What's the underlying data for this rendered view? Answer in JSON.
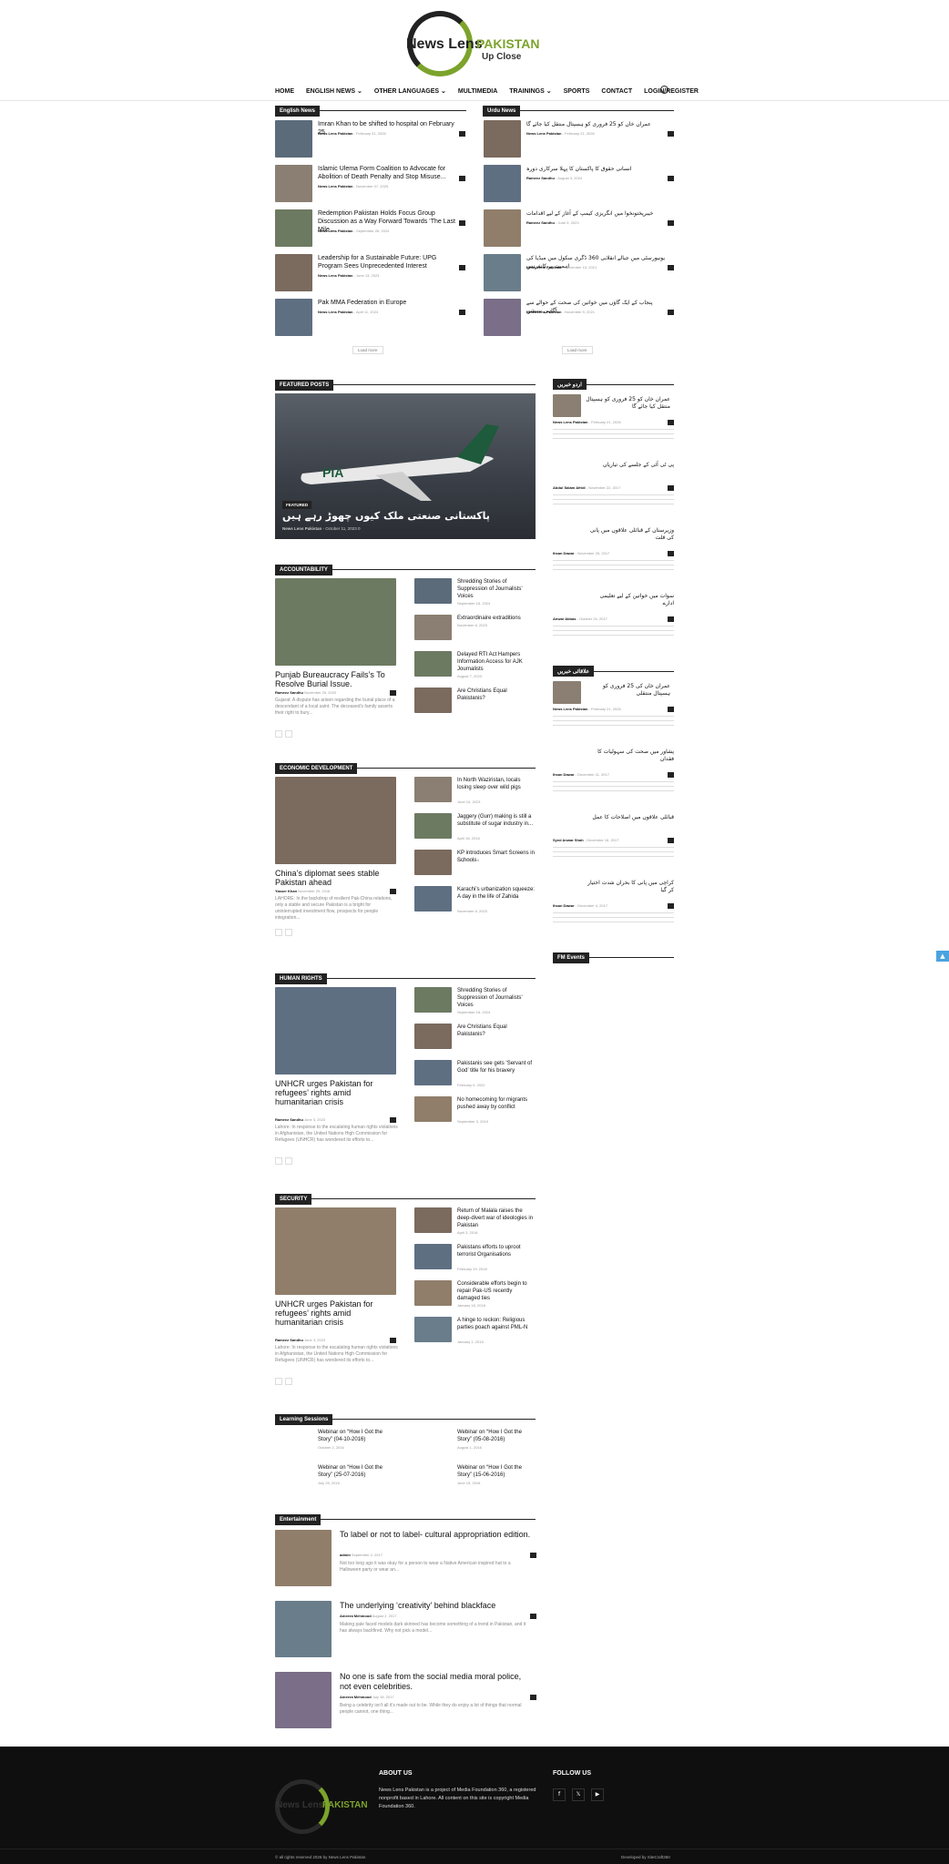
{
  "brand": {
    "line1": "News Lens",
    "line2": "PAKISTAN",
    "line3": "Up Close"
  },
  "nav": [
    "HOME",
    "ENGLISH NEWS ⌄",
    "OTHER LANGUAGES ⌄",
    "MULTIMEDIA",
    "TRAININGS ⌄",
    "SPORTS",
    "CONTACT",
    "LOGIN/REGISTER"
  ],
  "english_news": {
    "title": "English News",
    "load_more": "Load more",
    "items": [
      {
        "title": "Imran Khan to be shifted to hospital on February 25",
        "author": "News Lens Pakistan",
        "date": "February 21, 2026"
      },
      {
        "title": "Islamic Ulema Form Coalition to Advocate for Abolition of Death Penalty and Stop Misuse...",
        "author": "News Lens Pakistan",
        "date": "November 07, 2025"
      },
      {
        "title": "Redemption Pakistan Holds Focus Group Discussion as a Way Forward Towards ‘The Last Mile...",
        "author": "News Lens Pakistan",
        "date": "September 26, 2024"
      },
      {
        "title": "Leadership for a Sustainable Future: UPG Program Sees Unprecedented Interest",
        "author": "News Lens Pakistan",
        "date": "June 13, 2023"
      },
      {
        "title": "Pak MMA Federation in Europe",
        "author": "News Lens Pakistan",
        "date": "April 11, 2024"
      }
    ]
  },
  "urdu_news": {
    "title": "Urdu News",
    "load_more": "Load more",
    "items": [
      {
        "title": "عمران خان کو 25 فروری کو ہسپتال منتقل کیا جائے گا",
        "author": "News Lens Pakistan",
        "date": "February 21, 2026"
      },
      {
        "title": "انسانی حقوق کا پاکستان کا پہلا سرکاری دورہ",
        "author": "Rameez Sandhu",
        "date": "August 3, 2024"
      },
      {
        "title": "خیبرپختونخوا میں انگریزی کیمپ کے آغاز کے لیے اقدامات",
        "author": "Rameez Sandhu",
        "date": "June 5, 2023"
      },
      {
        "title": "یونیورسٹی میں جیالے انقلابی 360 ڈگری سکول میں میڈیا کی اہمیت پر کانفرنس",
        "author": "News Lens Pakistan",
        "date": "December 15, 2021"
      },
      {
        "title": "پنجاب کے ایک گاؤں میں خواتین کی صحت کے حوالے سے آگاہی سیشن",
        "author": "News Lens Pakistan",
        "date": "November 9, 2021"
      }
    ]
  },
  "featured": {
    "title": "FEATURED POSTS",
    "tag": "FEATURED",
    "headline": "پاکستانی صنعتی ملک کیوں چھوڑ رہے ہیں",
    "author": "News Lens Pakistan",
    "date": "October 11, 2023",
    "comments": "0",
    "tail": "PIA"
  },
  "urdu_side": {
    "title": "اردو خبریں",
    "items": [
      {
        "title": "عمران خان کو 25 فروری کو ہسپتال منتقل کیا جائے گا",
        "author": "News Lens Pakistan",
        "date": "February 21, 2026"
      },
      {
        "title": "پی ٹی آئی کے جلسے کی تیاریاں",
        "author": "Abdul Salam Afridi",
        "date": "November 22, 2017"
      },
      {
        "title": "وزیرستان کے قبائلی علاقوں میں پانی کی قلت",
        "author": "Ihsan Dawar",
        "date": "November 25, 2017"
      },
      {
        "title": "سوات میں خواتین کے لیے تعلیمی ادارے",
        "author": "Anwar Abbas",
        "date": "October 24, 2017"
      }
    ]
  },
  "regional_side": {
    "title": "علاقائی خبریں",
    "items": [
      {
        "title": "عمران خان کی 25 فروری کو ہسپتال منتقلی",
        "author": "News Lens Pakistan",
        "date": "February 21, 2026"
      },
      {
        "title": "پشاور میں صحت کی سہولیات کا فقدان",
        "author": "Ihsan Dawar",
        "date": "December 11, 2017"
      },
      {
        "title": "قبائلی علاقوں میں اصلاحات کا عمل",
        "author": "Syed Anwar Shah",
        "date": "December 18, 2017"
      },
      {
        "title": "کراچی میں پانی کا بحران شدت اختیار کر گیا",
        "author": "Ihsan Dawar",
        "date": "December 4, 2017"
      }
    ]
  },
  "fm_events": {
    "title": "FM Events"
  },
  "accountability": {
    "title": "ACCOUNTABILITY",
    "main": {
      "title": "Punjab Bureaucracy Fails’s To Resolve Burial Issue.",
      "author": "Rameez Sandhu",
      "date": "November 25, 2020",
      "excerpt": "Gujarat: A dispute has arisen regarding the burial place of a descendant of a local saint. The deceased's family asserts their right to bury..."
    },
    "side": [
      {
        "title": "Shredding Stories of Suppression of Journalists’ Voices",
        "date": "September 18, 2024"
      },
      {
        "title": "Extraordinaire extraditions",
        "date": "November 6, 2023"
      },
      {
        "title": "Delayed RTI Act Hampers Information Access for AJK Journalists",
        "date": "August 7, 2023"
      },
      {
        "title": "Are Christians Equal Pakistanis?",
        "date": "June 3, 2023"
      }
    ]
  },
  "economic": {
    "title": "ECONOMIC DEVELOPMENT",
    "main": {
      "title": "China’s diplomat sees stable Pakistan ahead",
      "author": "Yasser Khan",
      "date": "November 29, 2016",
      "excerpt": "LAHORE: In the backdrop of resilient Pak-China relations, only a stable and secure Pakistan is a bright for uninterrupted investment flow, prospects for people integration..."
    },
    "side": [
      {
        "title": "In North Waziristan, locals losing sleep over wild pigs",
        "date": "June 10, 2023"
      },
      {
        "title": "Jaggery (Gurr) making is still a substitute of sugar industry in...",
        "date": "April 18, 2018"
      },
      {
        "title": "KP introduces Smart Screens in Schools",
        "date": "May 23, 2018"
      },
      {
        "title": "Karachi’s urbanization squeeze: A day in the life of Zahida",
        "date": "November 6, 2023"
      }
    ]
  },
  "human_rights": {
    "title": "HUMAN RIGHTS",
    "main": {
      "title": "UNHCR urges Pakistan for refugees’ rights amid humanitarian crisis",
      "author": "Rameez Sandhu",
      "date": "June 3, 2023",
      "excerpt": "Lahore: In response to the escalating human rights violations in Afghanistan, the United Nations High Commission for Refugees (UNHCR) has wondered its efforts to..."
    },
    "side": [
      {
        "title": "Shredding Stories of Suppression of Journalists’ Voices",
        "date": "September 18, 2024"
      },
      {
        "title": "Are Christians Equal Pakistanis?",
        "date": "June 3, 2023"
      },
      {
        "title": "Pakistanis see gets ‘Servant of God’ title for his bravery",
        "date": "February 9, 2022"
      },
      {
        "title": "No homecoming for migrants pushed away by conflict",
        "date": "September 3, 2019"
      }
    ]
  },
  "security": {
    "title": "SECURITY",
    "main": {
      "title": "UNHCR urges Pakistan for refugees’ rights amid humanitarian crisis",
      "author": "Rameez Sandhu",
      "date": "June 3, 2023",
      "excerpt": "Lahore: In response to the escalating human rights violations in Afghanistan, the United Nations High Commission for Refugees (UNHCR) has wondered its efforts to..."
    },
    "side": [
      {
        "title": "Return of Malala raises the deep-divert war of ideologies in Pakistan",
        "date": "April 3, 2018"
      },
      {
        "title": "Pakistans efforts to uproot terrorist Organisations",
        "date": "February 19, 2018"
      },
      {
        "title": "Considerable efforts begin to repair Pak-US recently damaged ties",
        "date": "January 16, 2018"
      },
      {
        "title": "A hinge to reckon: Religious parties poach against PML-N",
        "date": "January 1, 2018"
      }
    ]
  },
  "learning": {
    "title": "Learning Sessions",
    "items": [
      {
        "title": "Webinar on “How I Got the Story” (04-10-2016)",
        "date": "October 2, 2016"
      },
      {
        "title": "Webinar on “How I Got the Story” (05-08-2016)",
        "date": "August 1, 2016"
      },
      {
        "title": "Webinar on “How I Got the Story” (25-07-2016)",
        "date": "July 25, 2016"
      },
      {
        "title": "Webinar on “How I Got the Story” (15-06-2016)",
        "date": "June 15, 2016"
      }
    ]
  },
  "entertainment": {
    "title": "Entertainment",
    "items": [
      {
        "title": "To label or not to label- cultural appropriation edition.",
        "author": "admin",
        "date": "September 2, 2017",
        "excerpt": "Not too long ago it was okay for a person to wear a Native American inspired hat to a Halloween party or wear an..."
      },
      {
        "title": "The underlying ‘creativity’ behind blackface",
        "author": "Ameera Mehmood",
        "date": "August 2, 2017",
        "excerpt": "Making pale faced models dark skinned has become something of a trend in Pakistan, and it has always backfired. Why not pick a model..."
      },
      {
        "title": "No one is safe from the social media moral police, not even celebrities.",
        "author": "Ameera Mehmood",
        "date": "July 18, 2017",
        "excerpt": "Being a celebrity isn't all it's made out to be. While they do enjoy a lot of things that normal people cannot, one thing..."
      }
    ]
  },
  "footer": {
    "about_title": "ABOUT US",
    "about": "News Lens Pakistan is a project of Media Foundation 360, a registered nonprofit based in Lahore. All content on this site is copyright Media Foundation 360.",
    "follow": "FOLLOW US",
    "social": [
      "f",
      "𝕏",
      "▶"
    ],
    "copyright": "© all rights reserved 2026 by News Lens Pakistan",
    "credit": "Developed by SiteCraft360"
  }
}
